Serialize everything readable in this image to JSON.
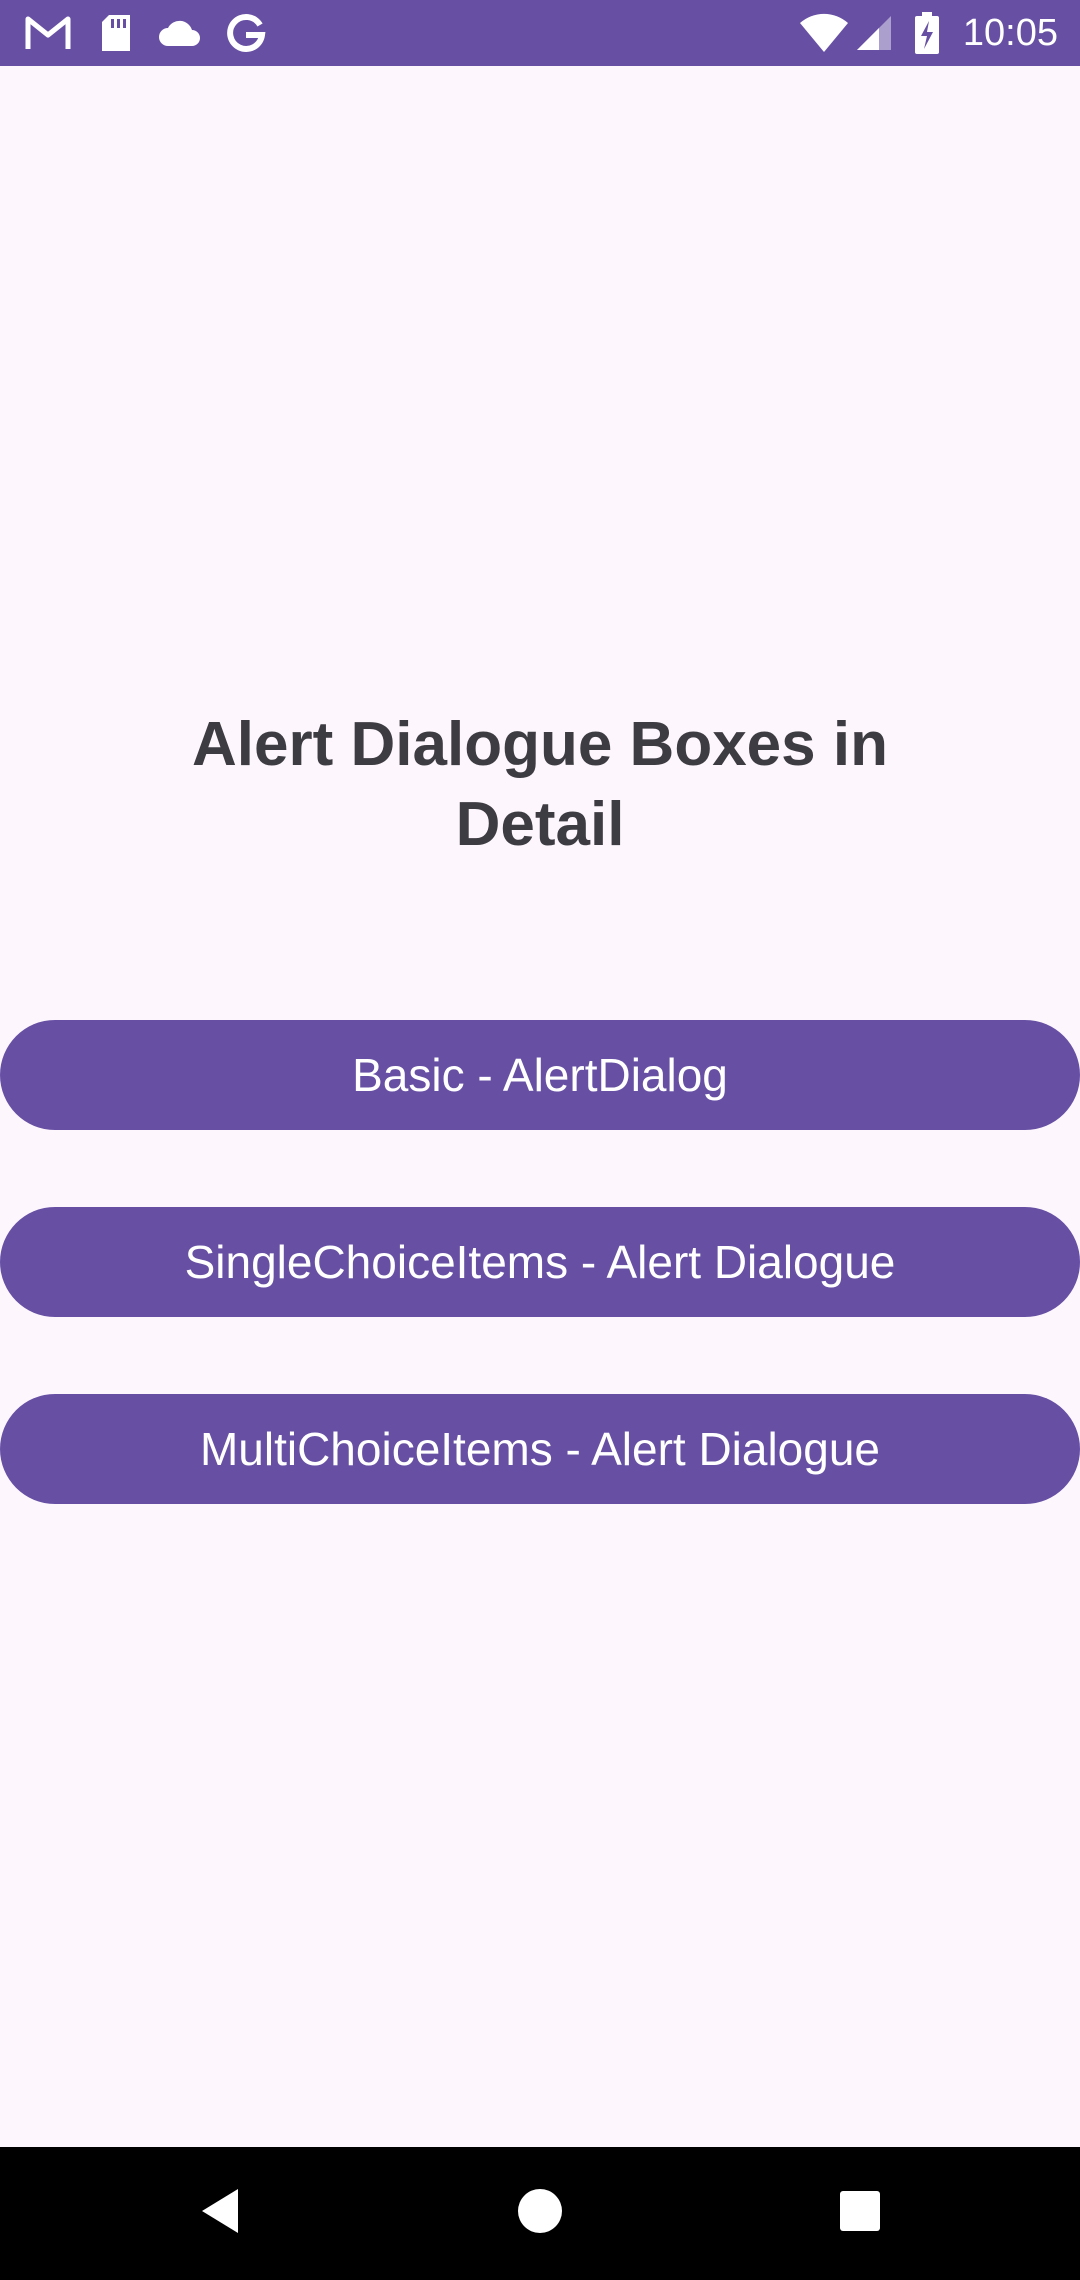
{
  "status_bar": {
    "time": "10:05",
    "left_icons": [
      "gmail-icon",
      "sd-card-icon",
      "cloud-icon",
      "google-icon"
    ],
    "right_icons": [
      "wifi-icon",
      "cell-signal-icon",
      "battery-charging-icon"
    ]
  },
  "main": {
    "title": "Alert Dialogue Boxes in Detail",
    "buttons": [
      {
        "label": "Basic - AlertDialog"
      },
      {
        "label": "SingleChoiceItems - Alert Dialogue"
      },
      {
        "label": "MultiChoiceItems - Alert Dialogue"
      }
    ]
  },
  "nav_bar": {
    "buttons": [
      "back-icon",
      "home-icon",
      "recents-icon"
    ]
  },
  "colors": {
    "accent": "#6750A4",
    "background": "#FDF7FD",
    "title_text": "#3E3C43",
    "nav_bar": "#000000"
  }
}
